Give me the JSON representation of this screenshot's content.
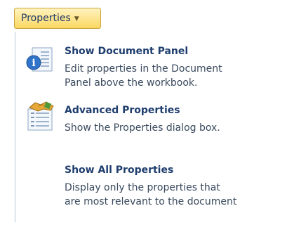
{
  "button": {
    "label": "Properties",
    "caret_icon": "chevron-down-icon"
  },
  "menu": {
    "items": [
      {
        "title": "Show Document Panel",
        "desc_line1": "Edit properties in the Document",
        "desc_line2": "Panel above the workbook.",
        "icon": "document-panel-info-icon"
      },
      {
        "title": "Advanced Properties",
        "desc_line1": "Show the Properties dialog box.",
        "icon": "advanced-properties-icon"
      },
      {
        "title": "Show All Properties",
        "desc_line1": "Display only the properties that",
        "desc_line2": "are most relevant to the document"
      }
    ]
  },
  "colors": {
    "button_bg_top": "#fff3bf",
    "button_bg_bottom": "#fbd863",
    "title_text": "#1f3e6e",
    "desc_text": "#3a4a5e",
    "info_blue": "#2f74c9"
  }
}
